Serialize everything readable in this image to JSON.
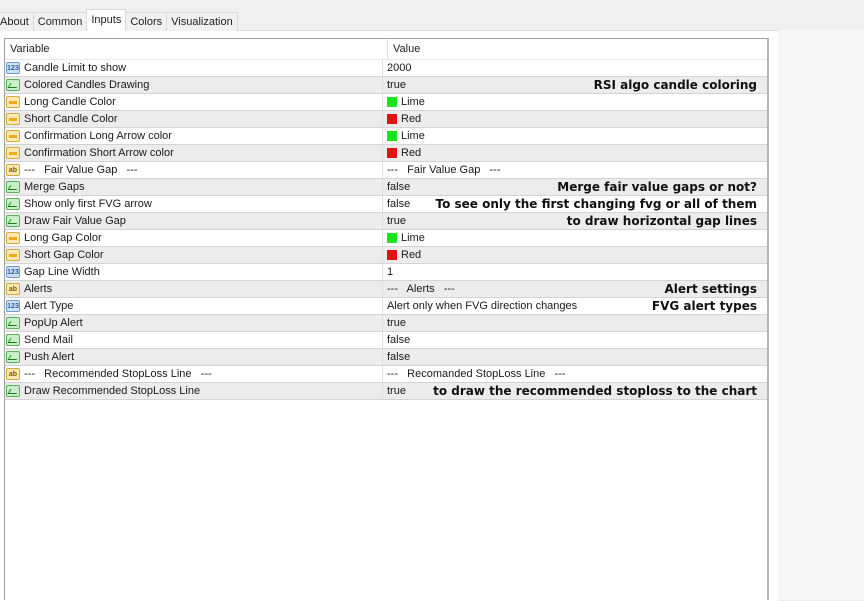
{
  "tabs": [
    {
      "label": "About",
      "active": false
    },
    {
      "label": "Common",
      "active": false
    },
    {
      "label": "Inputs",
      "active": true
    },
    {
      "label": "Colors",
      "active": false
    },
    {
      "label": "Visualization",
      "active": false
    }
  ],
  "table": {
    "headers": {
      "variable": "Variable",
      "value": "Value"
    },
    "rows": [
      {
        "icon": "number-icon",
        "type": "num",
        "variable": "Candle Limit to show",
        "value": "2000",
        "swatch": null,
        "note": ""
      },
      {
        "icon": "boolean-icon",
        "type": "bool",
        "variable": "Colored Candles Drawing",
        "value": "true",
        "swatch": null,
        "note": "RSI algo candle coloring"
      },
      {
        "icon": "color-icon",
        "type": "color",
        "variable": "Long Candle Color",
        "value": "Lime",
        "swatch": "#19e619",
        "note": ""
      },
      {
        "icon": "color-icon",
        "type": "color",
        "variable": "Short Candle Color",
        "value": "Red",
        "swatch": "#e21212",
        "note": ""
      },
      {
        "icon": "color-icon",
        "type": "color",
        "variable": "Confirmation Long Arrow color",
        "value": "Lime",
        "swatch": "#19e619",
        "note": ""
      },
      {
        "icon": "color-icon",
        "type": "color",
        "variable": "Confirmation Short Arrow color",
        "value": "Red",
        "swatch": "#e21212",
        "note": ""
      },
      {
        "icon": "string-icon",
        "type": "str",
        "variable": "---   Fair Value Gap   ---",
        "value": "---   Fair Value Gap   ---",
        "swatch": null,
        "note": ""
      },
      {
        "icon": "boolean-icon",
        "type": "bool",
        "variable": "Merge Gaps",
        "value": "false",
        "swatch": null,
        "note": "Merge fair value gaps or not?"
      },
      {
        "icon": "boolean-icon",
        "type": "bool",
        "variable": "Show only first FVG arrow",
        "value": "false",
        "swatch": null,
        "note": "To see only the first changing fvg or all of them"
      },
      {
        "icon": "boolean-icon",
        "type": "bool",
        "variable": "Draw Fair Value Gap",
        "value": "true",
        "swatch": null,
        "note": "to draw horizontal gap lines"
      },
      {
        "icon": "color-icon",
        "type": "color",
        "variable": "Long Gap Color",
        "value": "Lime",
        "swatch": "#19e619",
        "note": ""
      },
      {
        "icon": "color-icon",
        "type": "color",
        "variable": "Short Gap Color",
        "value": "Red",
        "swatch": "#e21212",
        "note": ""
      },
      {
        "icon": "number-icon",
        "type": "num",
        "variable": "Gap Line Width",
        "value": "1",
        "swatch": null,
        "note": ""
      },
      {
        "icon": "string-icon",
        "type": "str",
        "variable": "Alerts",
        "value": "---   Alerts   ---",
        "swatch": null,
        "note": "Alert settings"
      },
      {
        "icon": "number-icon",
        "type": "num",
        "variable": "Alert Type",
        "value": "Alert only when FVG direction changes",
        "swatch": null,
        "note": "FVG alert types"
      },
      {
        "icon": "boolean-icon",
        "type": "bool",
        "variable": "PopUp Alert",
        "value": "true",
        "swatch": null,
        "note": ""
      },
      {
        "icon": "boolean-icon",
        "type": "bool",
        "variable": "Send Mail",
        "value": "false",
        "swatch": null,
        "note": ""
      },
      {
        "icon": "boolean-icon",
        "type": "bool",
        "variable": "Push Alert",
        "value": "false",
        "swatch": null,
        "note": ""
      },
      {
        "icon": "string-icon",
        "type": "str",
        "variable": "---   Recommended StopLoss Line   ---",
        "value": "---   Recomanded StopLoss Line   ---",
        "swatch": null,
        "note": ""
      },
      {
        "icon": "boolean-icon",
        "type": "bool",
        "variable": "Draw Recommended StopLoss Line",
        "value": "true",
        "swatch": null,
        "note": "to draw the recommended stoploss to the chart"
      }
    ]
  }
}
